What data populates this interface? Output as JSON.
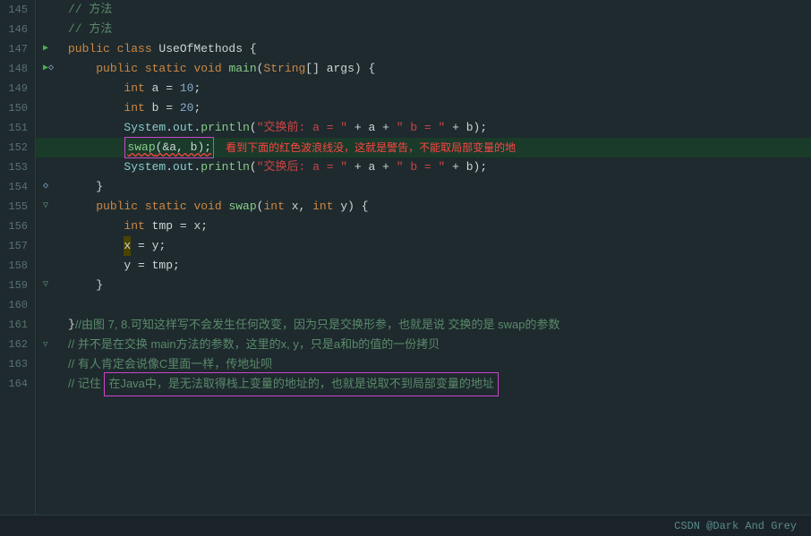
{
  "lines": [
    {
      "num": 145,
      "gutter": "",
      "code": "// 方法",
      "type": "comment"
    },
    {
      "num": 146,
      "gutter": "",
      "code": "// 方法",
      "type": "comment_only"
    },
    {
      "num": 147,
      "gutter": "arrow",
      "code": "public class UseOfMethods {",
      "type": "class_decl"
    },
    {
      "num": 148,
      "gutter": "arrow_break",
      "code": "    public static void main(String[] args) {",
      "type": "method_decl"
    },
    {
      "num": 149,
      "gutter": "",
      "code": "        int a = 10;",
      "type": "var_decl"
    },
    {
      "num": 150,
      "gutter": "",
      "code": "        int b = 20;",
      "type": "var_decl"
    },
    {
      "num": 151,
      "gutter": "",
      "code": "        System.out.println(\"交换前: a = \" + a + \" b = \" + b);",
      "type": "sysout"
    },
    {
      "num": 152,
      "gutter": "",
      "code": "        swap(&a, b);",
      "type": "swap_call",
      "highlight": true
    },
    {
      "num": 153,
      "gutter": "",
      "code": "        System.out.println(\"交换后: a = \" + a + \" b = \" + b);",
      "type": "sysout"
    },
    {
      "num": 154,
      "gutter": "",
      "code": "    }",
      "type": "brace"
    },
    {
      "num": 155,
      "gutter": "arrow_down",
      "code": "    public static void swap(int x, int y) {",
      "type": "method_decl2"
    },
    {
      "num": 156,
      "gutter": "",
      "code": "        int tmp = x;",
      "type": "var_decl"
    },
    {
      "num": 157,
      "gutter": "",
      "code": "        x = y;",
      "type": "assign",
      "highlight_x": true
    },
    {
      "num": 158,
      "gutter": "",
      "code": "        y = tmp;",
      "type": "assign"
    },
    {
      "num": 159,
      "gutter": "arrow_down2",
      "code": "    }",
      "type": "brace"
    },
    {
      "num": 160,
      "gutter": "",
      "code": "",
      "type": "empty"
    },
    {
      "num": 161,
      "gutter": "",
      "code": "}//由图 7, 8.可知这样写不会发生任何改变，因为只是交换形参，也就是说 交换的是 swap的参数",
      "type": "comment_cjk"
    },
    {
      "num": 162,
      "gutter": "arrow_down3",
      "code": "// 并不是在交换 main方法的参数，这里的x, y，只是a和b的值的一份拷贝",
      "type": "comment_cjk"
    },
    {
      "num": 163,
      "gutter": "",
      "code": "// 有人肯定会说像C里面一样，传地址呗",
      "type": "comment_cjk"
    },
    {
      "num": 164,
      "gutter": "",
      "code": "// 记住 在Java中，是无法取得栈上变量的地址的，也就是说取不到局部变量的地址",
      "type": "comment_cjk_box"
    }
  ],
  "statusbar": {
    "label": "CSDN @Dark And Grey"
  },
  "annotation_152": "看到下面的红色波浪线没，这就是警告，不能取局部变量的地",
  "colors": {
    "background": "#1e2a2e",
    "linenum": "#5a7070",
    "keyword": "#cc8844",
    "comment": "#5a8a6a",
    "string": "#cc4444",
    "number": "#cdd6d8",
    "highlight_bg": "#1a3a2a"
  }
}
